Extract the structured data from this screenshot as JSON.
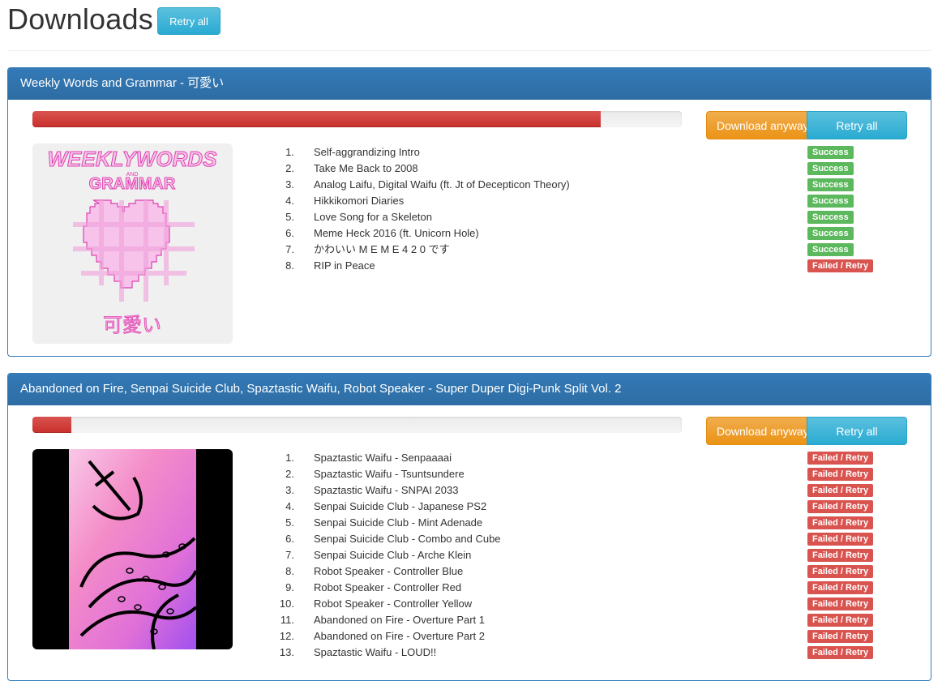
{
  "header": {
    "title": "Downloads",
    "retry_all_label": "Retry all"
  },
  "albums": [
    {
      "title": "Weekly Words and Grammar - 可愛い",
      "progress_percent": 87.5,
      "download_anyway_label": "Download anyway",
      "retry_all_label": "Retry all",
      "cover_art": "weekly-words-and-grammar-pink-pixel-heart",
      "tracks": [
        {
          "num": "1.",
          "title": "Self-aggrandizing Intro",
          "status": "Success"
        },
        {
          "num": "2.",
          "title": "Take Me Back to 2008",
          "status": "Success"
        },
        {
          "num": "3.",
          "title": "Analog Laifu, Digital Waifu (ft. Jt of Decepticon Theory)",
          "status": "Success"
        },
        {
          "num": "4.",
          "title": "Hikkikomori Diaries",
          "status": "Success"
        },
        {
          "num": "5.",
          "title": "Love Song for a Skeleton",
          "status": "Success"
        },
        {
          "num": "6.",
          "title": "Meme Heck 2016 (ft. Unicorn Hole)",
          "status": "Success"
        },
        {
          "num": "7.",
          "title": "かわいい M E M E 4 2 0 です",
          "status": "Success"
        },
        {
          "num": "8.",
          "title": "RIP in Peace",
          "status": "Failed / Retry"
        }
      ]
    },
    {
      "title": "Abandoned on Fire, Senpai Suicide Club, Spaztastic Waifu, Robot Speaker - Super Duper Digi-Punk Split Vol. 2",
      "progress_percent": 6,
      "download_anyway_label": "Download anyway",
      "retry_all_label": "Retry all",
      "cover_art": "anchor-and-tentacles-pink-purple",
      "tracks": [
        {
          "num": "1.",
          "title": "Spaztastic Waifu - Senpaaaai",
          "status": "Failed / Retry"
        },
        {
          "num": "2.",
          "title": "Spaztastic Waifu - Tsuntsundere",
          "status": "Failed / Retry"
        },
        {
          "num": "3.",
          "title": "Spaztastic Waifu - SNPAI 2033",
          "status": "Failed / Retry"
        },
        {
          "num": "4.",
          "title": "Senpai Suicide Club - Japanese PS2",
          "status": "Failed / Retry"
        },
        {
          "num": "5.",
          "title": "Senpai Suicide Club - Mint Adenade",
          "status": "Failed / Retry"
        },
        {
          "num": "6.",
          "title": "Senpai Suicide Club - Combo and Cube",
          "status": "Failed / Retry"
        },
        {
          "num": "7.",
          "title": "Senpai Suicide Club - Arche Klein",
          "status": "Failed / Retry"
        },
        {
          "num": "8.",
          "title": "Robot Speaker - Controller Blue",
          "status": "Failed / Retry"
        },
        {
          "num": "9.",
          "title": "Robot Speaker - Controller Red",
          "status": "Failed / Retry"
        },
        {
          "num": "10.",
          "title": "Robot Speaker - Controller Yellow",
          "status": "Failed / Retry"
        },
        {
          "num": "11.",
          "title": "Abandoned on Fire - Overture Part 1",
          "status": "Failed / Retry"
        },
        {
          "num": "12.",
          "title": "Abandoned on Fire - Overture Part 2",
          "status": "Failed / Retry"
        },
        {
          "num": "13.",
          "title": "Spaztastic Waifu - LOUD!!",
          "status": "Failed / Retry"
        }
      ]
    }
  ],
  "colors": {
    "panel_primary": "#337ab7",
    "progress_danger": "#d9534f",
    "success": "#5cb85c",
    "failed": "#d9534f",
    "info": "#5bc0de",
    "warning": "#f0ad4e"
  }
}
